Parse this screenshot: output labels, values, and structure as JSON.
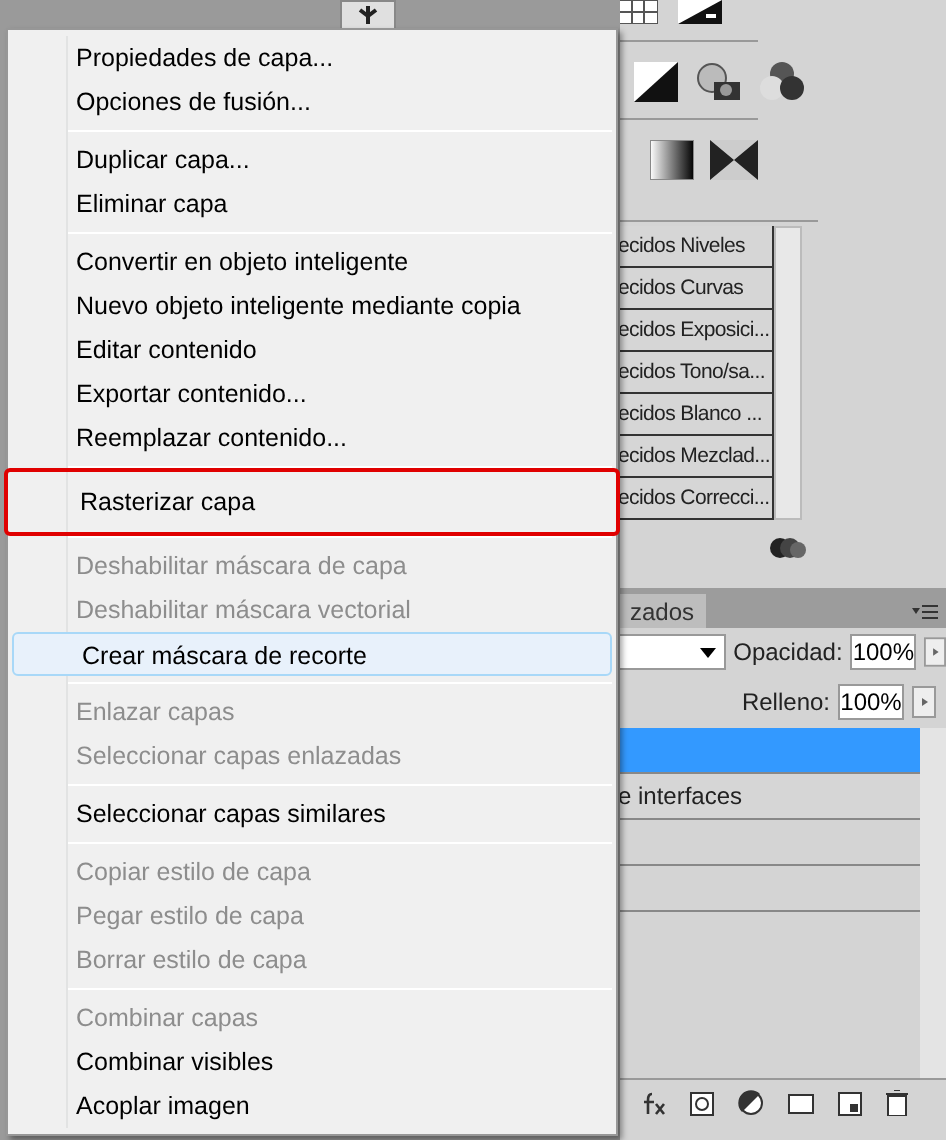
{
  "presets": [
    "ecidos Niveles",
    "ecidos Curvas",
    "ecidos Exposici...",
    "ecidos Tono/sa...",
    "ecidos Blanco ...",
    "ecidos Mezclad...",
    "ecidos Correcci..."
  ],
  "layers_panel": {
    "tab": "zados",
    "opacity_label": "Opacidad:",
    "opacity": "100%",
    "fill_label": "Relleno:",
    "fill": "100%",
    "layers": [
      {
        "selected": true
      },
      {
        "name": "e interfaces",
        "selected": false
      }
    ]
  },
  "menu": {
    "groups": [
      {
        "items": [
          {
            "label": "Propiedades de capa...",
            "disabled": false,
            "hovered": false,
            "annotated": false
          },
          {
            "label": "Opciones de fusión...",
            "disabled": false,
            "hovered": false,
            "annotated": false
          }
        ]
      },
      {
        "items": [
          {
            "label": "Duplicar capa...",
            "disabled": false,
            "hovered": false,
            "annotated": false
          },
          {
            "label": "Eliminar capa",
            "disabled": false,
            "hovered": false,
            "annotated": false
          }
        ]
      },
      {
        "items": [
          {
            "label": "Convertir en objeto inteligente",
            "disabled": false,
            "hovered": false,
            "annotated": false
          },
          {
            "label": "Nuevo objeto inteligente mediante copia",
            "disabled": false,
            "hovered": false,
            "annotated": false
          },
          {
            "label": "Editar contenido",
            "disabled": false,
            "hovered": false,
            "annotated": false
          },
          {
            "label": "Exportar contenido...",
            "disabled": false,
            "hovered": false,
            "annotated": false
          },
          {
            "label": "Reemplazar contenido...",
            "disabled": false,
            "hovered": false,
            "annotated": false
          }
        ]
      },
      {
        "items": [
          {
            "label": "Rasterizar capa",
            "disabled": false,
            "hovered": false,
            "annotated": true
          }
        ]
      },
      {
        "items": [
          {
            "label": "Deshabilitar máscara de capa",
            "disabled": true,
            "hovered": false,
            "annotated": false
          },
          {
            "label": "Deshabilitar máscara vectorial",
            "disabled": true,
            "hovered": false,
            "annotated": false
          },
          {
            "label": "Crear máscara de recorte",
            "disabled": false,
            "hovered": true,
            "annotated": false
          }
        ]
      },
      {
        "items": [
          {
            "label": "Enlazar capas",
            "disabled": true,
            "hovered": false,
            "annotated": false
          },
          {
            "label": "Seleccionar capas enlazadas",
            "disabled": true,
            "hovered": false,
            "annotated": false
          }
        ]
      },
      {
        "items": [
          {
            "label": "Seleccionar capas similares",
            "disabled": false,
            "hovered": false,
            "annotated": false
          }
        ]
      },
      {
        "items": [
          {
            "label": "Copiar estilo de capa",
            "disabled": true,
            "hovered": false,
            "annotated": false
          },
          {
            "label": "Pegar estilo de capa",
            "disabled": true,
            "hovered": false,
            "annotated": false
          },
          {
            "label": "Borrar estilo de capa",
            "disabled": true,
            "hovered": false,
            "annotated": false
          }
        ]
      },
      {
        "items": [
          {
            "label": "Combinar capas",
            "disabled": true,
            "hovered": false,
            "annotated": false
          },
          {
            "label": "Combinar visibles",
            "disabled": false,
            "hovered": false,
            "annotated": false
          },
          {
            "label": "Acoplar imagen",
            "disabled": false,
            "hovered": false,
            "annotated": false
          }
        ]
      }
    ]
  }
}
